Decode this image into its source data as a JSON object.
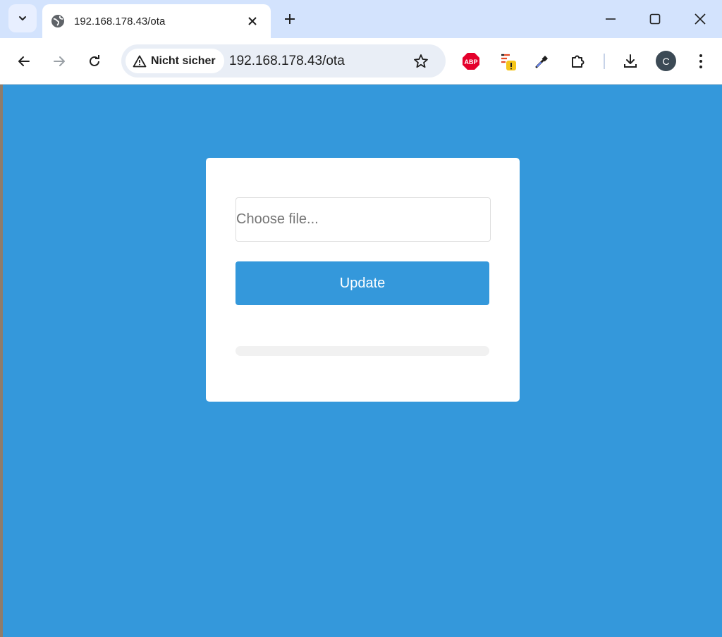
{
  "browser": {
    "tab": {
      "title": "192.168.178.43/ota"
    },
    "security_label": "Nicht sicher",
    "url": "192.168.178.43/ota",
    "abp_label": "ABP",
    "profile_initial": "C"
  },
  "form": {
    "file_placeholder": "Choose file...",
    "update_label": "Update",
    "progress_fraction": 0
  },
  "colors": {
    "page_background": "#3498db",
    "button": "#3498db",
    "card": "#ffffff"
  }
}
